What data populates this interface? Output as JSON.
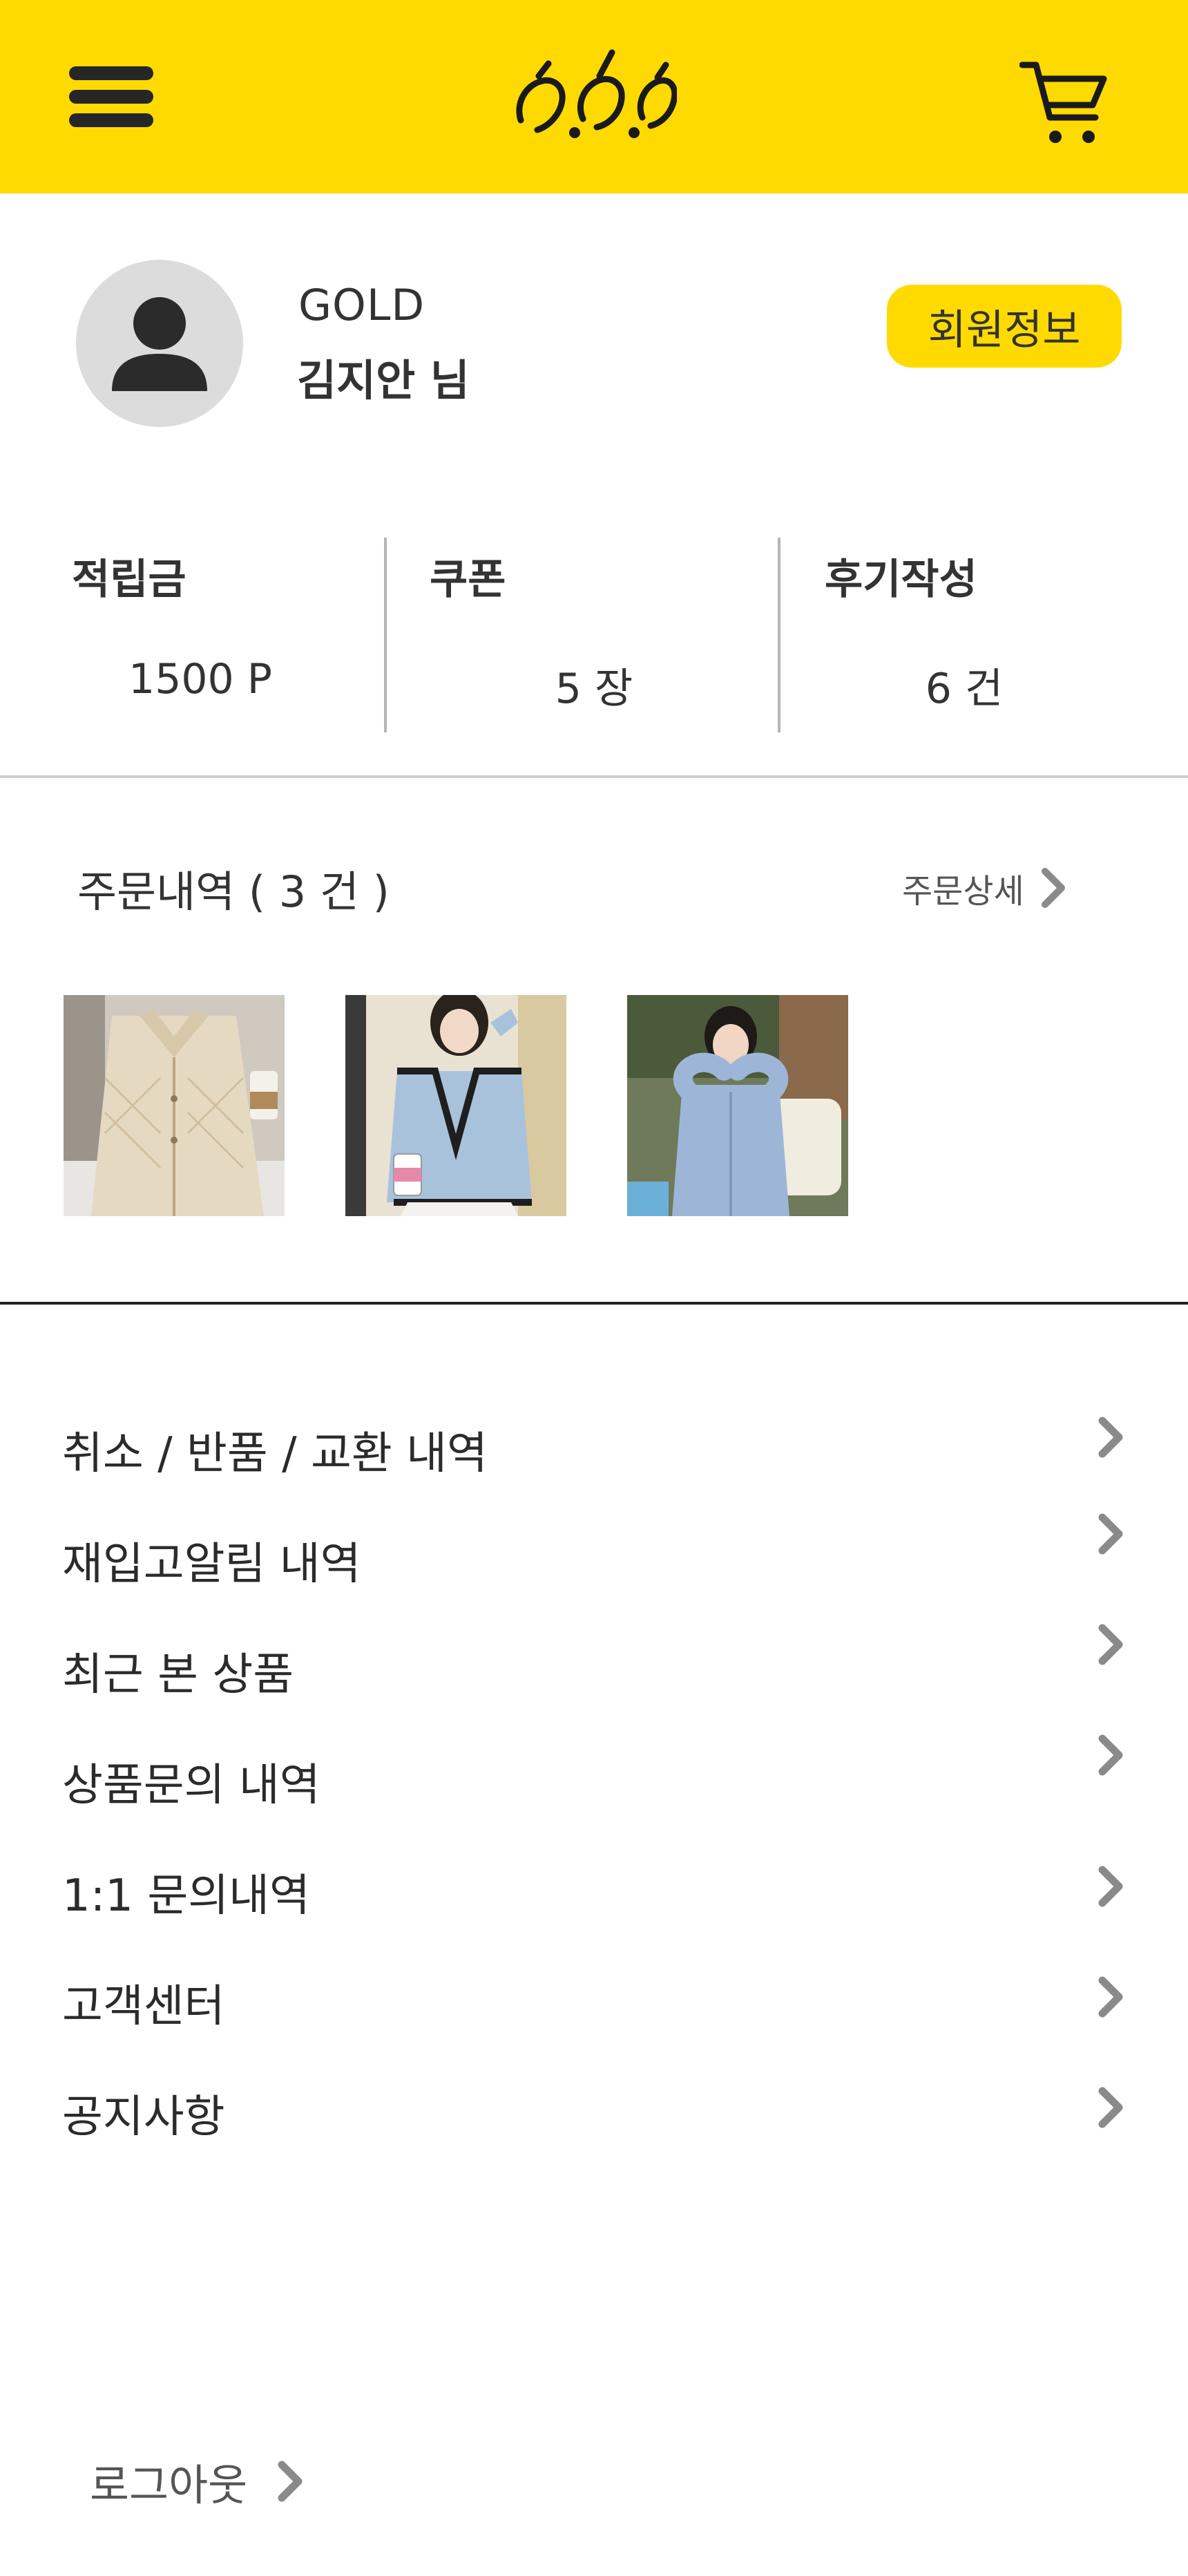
{
  "header": {
    "menu_icon": "hamburger-menu-icon",
    "logo_icon": "brand-logo",
    "cart_icon": "shopping-cart-icon",
    "background_color": "#FFDA00"
  },
  "profile": {
    "avatar_icon": "user-avatar-icon",
    "grade": "GOLD",
    "name": "김지안 님",
    "member_info_button": "회원정보"
  },
  "stats": [
    {
      "label": "적립금",
      "value": "1500 P"
    },
    {
      "label": "쿠폰",
      "value": "5 장"
    },
    {
      "label": "후기작성",
      "value": "6 건"
    }
  ],
  "orders": {
    "title": "주문내역 ( 3 건 )",
    "detail_link": "주문상세",
    "items": [
      {
        "name": "beige-quilted-jacket"
      },
      {
        "name": "light-blue-tweed-cardigan"
      },
      {
        "name": "light-blue-knit-cardigan"
      }
    ]
  },
  "menu": {
    "items": [
      {
        "label": "취소 / 반품 / 교환 내역"
      },
      {
        "label": "재입고알림 내역"
      },
      {
        "label": "최근 본 상품"
      },
      {
        "label": "상품문의 내역"
      },
      {
        "label": "1:1 문의내역"
      },
      {
        "label": "고객센터"
      },
      {
        "label": "공지사항"
      }
    ]
  },
  "logout": "로그아웃",
  "colors": {
    "accent": "#FFDA00",
    "text": "#2b2b2b",
    "chevron": "#8a8a8a"
  }
}
